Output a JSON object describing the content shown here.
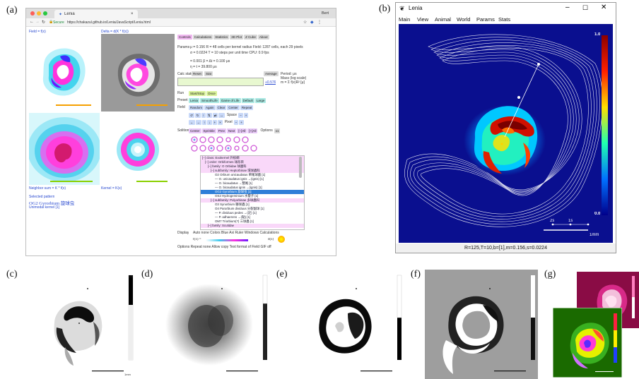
{
  "labels": {
    "a": "(a)",
    "b": "(b)",
    "c": "(c)",
    "d": "(d)",
    "e": "(e)",
    "f": "(f)",
    "g": "(g)"
  },
  "browser": {
    "tab_title": "Lenia",
    "user": "Bert",
    "secure": "Secure",
    "url": "https://chakazul.github.io/Lenia/JavaScript/Lenia.html",
    "field_label": "Field = f(x)",
    "delta_label": "Delta = d(K * f(x))",
    "neighbor_label": "Neighbor sum = K * f(x)",
    "kernel_label": "Kernel = K(x)",
    "selected_label": "Selected pattern",
    "selected_name": "OG2 Gyrorbium 旋球虫",
    "selected_sub": "Unimodal kernel [1]",
    "tabs": [
      "Controls",
      "Calculations",
      "Statistics",
      "3D Plot",
      "Z Cube",
      "About"
    ],
    "params_label": "Params",
    "params_line1": "μ = 0.156    R = 48 cells per kernel radius    Field: 1287 cells, each 29 pixels",
    "params_line2": "σ = 0.0224    T = 10 steps per unit time    CPU: 0.9 fps",
    "params_line3": "= 0.001    β =    Δt = 0.100 μs",
    "params_line4": "η =    t = 39.800 μs",
    "calc_label": "Calc state",
    "reset": "Reset",
    "stat": "Stat",
    "average": "Average",
    "period": "Period: μs",
    "mass_label": "Mass (log scale)",
    "mass_formula": "m = Σ f(x)R²  [μ]",
    "mass_value": "+0.576",
    "run_label": "Run",
    "run_btns": [
      "Start/Stop",
      "Once"
    ],
    "preset_label": "Preset",
    "preset_btns": [
      "Lenia",
      "SmoothLife",
      "Game of Life",
      "Default",
      "Large"
    ],
    "field_row_label": "Field",
    "field_btns": [
      "Random",
      "Again",
      "Clear",
      "Center",
      "Repeat"
    ],
    "space_label": "Space",
    "pixel_label": "Pixel",
    "solition_label": "Solition",
    "solition_btns": [
      "Center",
      "Sprinkle",
      "Prev",
      "Next",
      "[–]All",
      "[+]All"
    ],
    "options_label": "Options",
    "options_value": "x1",
    "tree": [
      "[–] class: Exokernel 外核綱",
      "[–] order: Orbiformes 球形目",
      "[–] family: O Orbidae 球蟲科",
      "[–] subfamily: Heptorbinae 環球蟲科",
      "O2 Orbium unicaudatus 單尾球蟲 [1]",
      "— O. unicaudatus ignis →(ignis) [1]",
      "— O. bicaudatus →雙尾 [1]",
      "— O. bicaudatus ignis →(ignis) [1]",
      "OG2 Gyrorbium 旋球虫 [1]",
      "OS2 Hydrogeminium 水雙子 [1]",
      "[–] subfamily: Polyorbinae 多球蟲科",
      "O3 Synorbium 聯球蟲 [1]",
      "O4 Parorbium dividuus 分裂副球 [1]",
      "— P. dividuus pedes →(足) [1]",
      "— P. adhaerens →(黏) [1]",
      "OM7 Triorbium(?) 三球蟲 [1]",
      "[–] family: Scutidae"
    ],
    "display_label": "Display",
    "display_line": "Auto none  Colors Blue  Axi Ruler  Windows Calculations",
    "formula_line": "f(x) =",
    "dk_label": "d(x)",
    "options_line": "Options  Repeat none  Allow copy Text  format of Field  GIF  off"
  },
  "lenia_app": {
    "title": "Lenia",
    "menu": [
      "Main",
      "View",
      "Animal",
      "World",
      "Params",
      "Stats"
    ],
    "colorbar_max": "1.0",
    "colorbar_min": "0.0",
    "time_labels": [
      "2s",
      "1s"
    ],
    "scale_label": "1mm",
    "status": "R=125,T=10,b=[1],m=0.156,s=0.0224"
  },
  "colors": {
    "blue_bg": "#0a0f8f",
    "accent_magenta": "#ff2fd8",
    "accent_cyan": "#22d3ee"
  }
}
